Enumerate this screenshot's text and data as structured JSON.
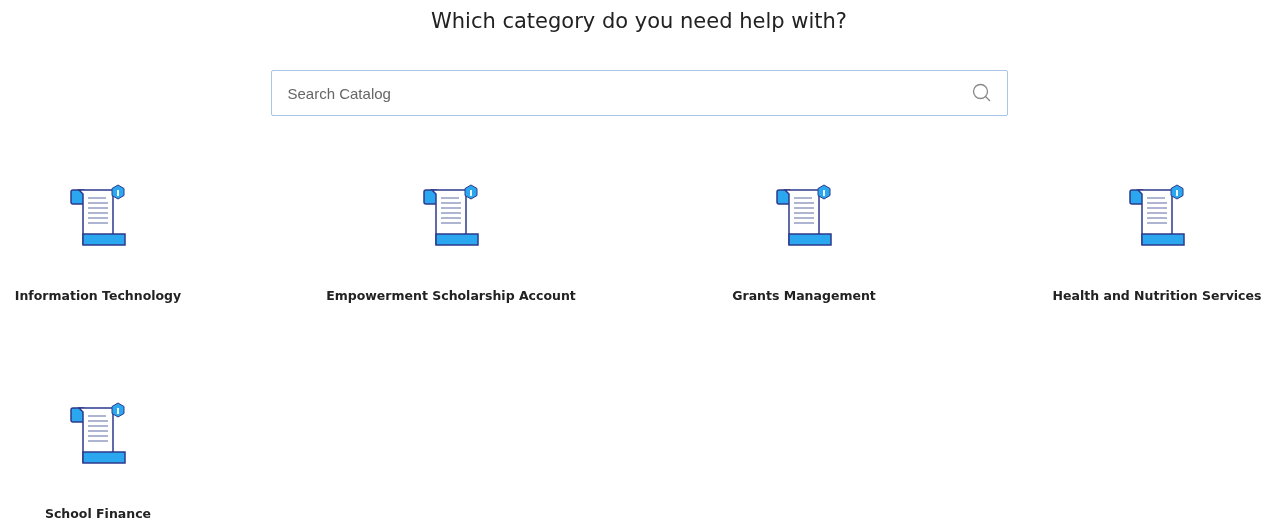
{
  "heading": "Which category do you need help with?",
  "search": {
    "placeholder": "Search Catalog"
  },
  "categories": [
    {
      "label": "Information Technology"
    },
    {
      "label": "Empowerment Scholarship Account"
    },
    {
      "label": "Grants Management"
    },
    {
      "label": "Health and Nutrition Services"
    },
    {
      "label": "School Finance"
    }
  ]
}
